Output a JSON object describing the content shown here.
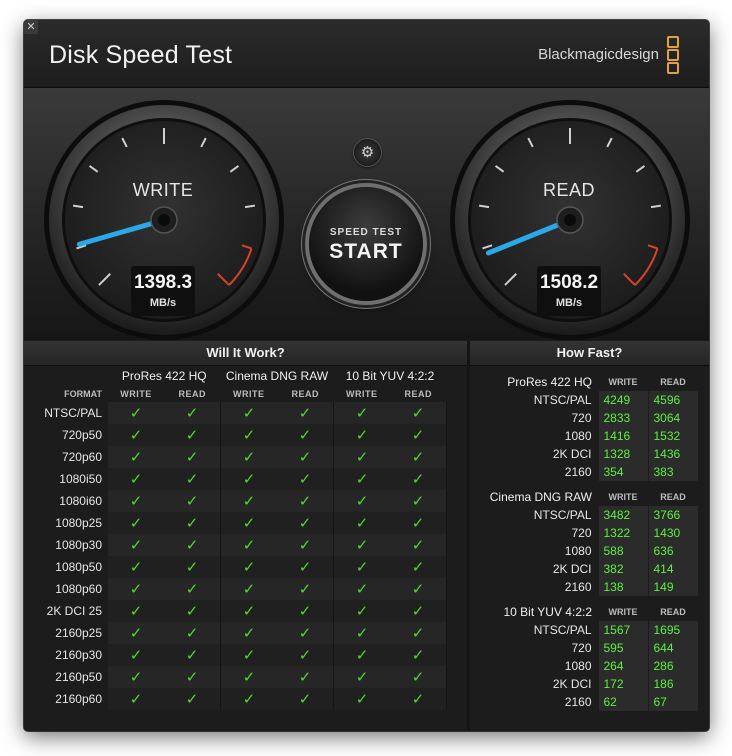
{
  "window": {
    "title": "Disk Speed Test",
    "brand": "Blackmagicdesign",
    "close_symbol": "✕"
  },
  "colors": {
    "accent_needle": "#2aa8e8",
    "check": "#4ddb2e",
    "value": "#5ef040",
    "redline": "#d8432b",
    "brand_logo": "#e3a13d"
  },
  "gauges": {
    "write": {
      "label": "WRITE",
      "value": "1398.3",
      "unit": "MB/s",
      "needle_angle": -16
    },
    "read": {
      "label": "READ",
      "value": "1508.2",
      "unit": "MB/s",
      "needle_angle": -22
    }
  },
  "controls": {
    "settings_icon": "⚙",
    "start_sub": "SPEED TEST",
    "start_main": "START"
  },
  "will_it_work": {
    "title": "Will It Work?",
    "format_header": "FORMAT",
    "groups": [
      "ProRes 422 HQ",
      "Cinema DNG RAW",
      "10 Bit YUV 4:2:2"
    ],
    "col_write": "WRITE",
    "col_read": "READ",
    "check_symbol": "✓",
    "rows": [
      "NTSC/PAL",
      "720p50",
      "720p60",
      "1080i50",
      "1080i60",
      "1080p25",
      "1080p30",
      "1080p50",
      "1080p60",
      "2K DCI 25",
      "2160p25",
      "2160p30",
      "2160p50",
      "2160p60"
    ]
  },
  "how_fast": {
    "title": "How Fast?",
    "col_write": "WRITE",
    "col_read": "READ",
    "groups": [
      {
        "name": "ProRes 422 HQ",
        "rows": [
          {
            "label": "NTSC/PAL",
            "write": "4249",
            "read": "4596"
          },
          {
            "label": "720",
            "write": "2833",
            "read": "3064"
          },
          {
            "label": "1080",
            "write": "1416",
            "read": "1532"
          },
          {
            "label": "2K DCI",
            "write": "1328",
            "read": "1436"
          },
          {
            "label": "2160",
            "write": "354",
            "read": "383"
          }
        ]
      },
      {
        "name": "Cinema DNG RAW",
        "rows": [
          {
            "label": "NTSC/PAL",
            "write": "3482",
            "read": "3766"
          },
          {
            "label": "720",
            "write": "1322",
            "read": "1430"
          },
          {
            "label": "1080",
            "write": "588",
            "read": "636"
          },
          {
            "label": "2K DCI",
            "write": "382",
            "read": "414"
          },
          {
            "label": "2160",
            "write": "138",
            "read": "149"
          }
        ]
      },
      {
        "name": "10 Bit YUV 4:2:2",
        "rows": [
          {
            "label": "NTSC/PAL",
            "write": "1567",
            "read": "1695"
          },
          {
            "label": "720",
            "write": "595",
            "read": "644"
          },
          {
            "label": "1080",
            "write": "264",
            "read": "286"
          },
          {
            "label": "2K DCI",
            "write": "172",
            "read": "186"
          },
          {
            "label": "2160",
            "write": "62",
            "read": "67"
          }
        ]
      }
    ]
  }
}
